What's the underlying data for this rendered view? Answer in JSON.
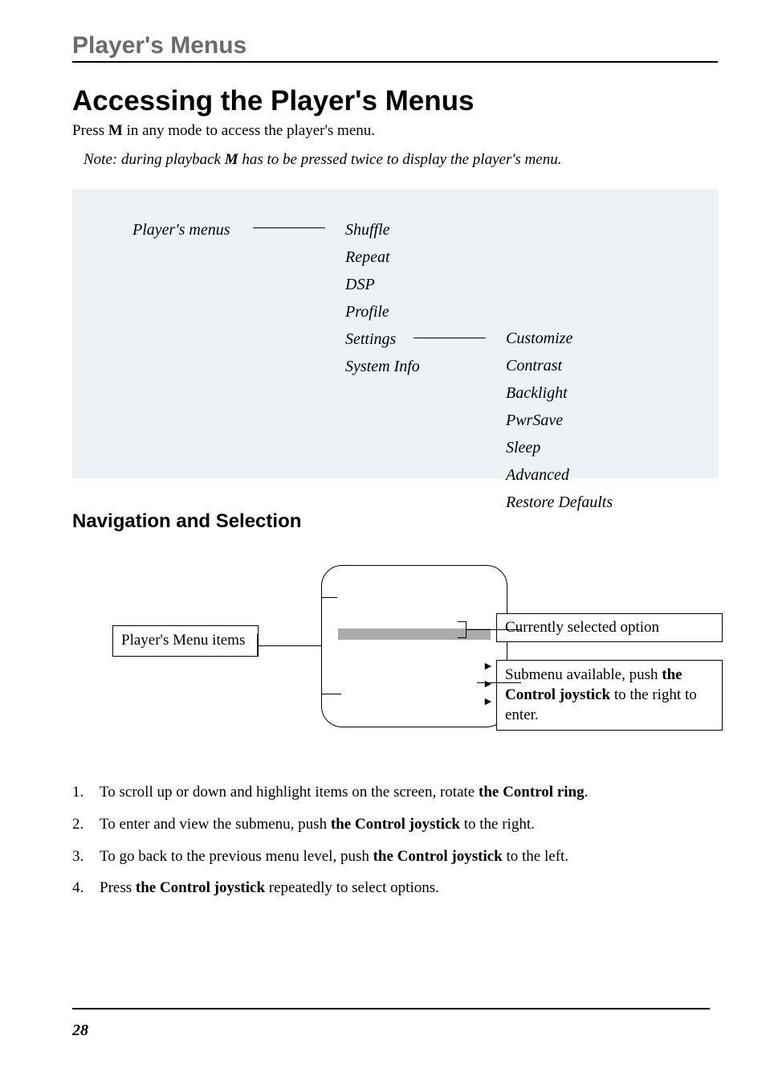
{
  "chapter": "Player's Menus",
  "h1": "Accessing the Player's Menus",
  "press1": "Press ",
  "press_key": "M",
  "press2": " in any mode to access the player's menu.",
  "note_pre": "Note: during playback ",
  "note_key": "M",
  "note_post": " has to be pressed twice to display the player's menu.",
  "menu_col1": "Player's menus",
  "menu_col2": [
    "Shuffle",
    "Repeat",
    "DSP",
    "Profile",
    "Settings",
    "System Info"
  ],
  "menu_col3": [
    "Customize",
    "Contrast",
    "Backlight",
    "PwrSave",
    "Sleep",
    "Advanced",
    "Restore Defaults"
  ],
  "h2": "Navigation and Selection",
  "diagram": {
    "left_label": "Player's Menu items",
    "top_right": "Currently selected option",
    "bottom_right_pre": "Submenu available, push ",
    "bottom_right_bold": "the Control joystick",
    "bottom_right_post": " to the right to enter."
  },
  "steps": [
    {
      "n": "1.",
      "pre": "To scroll up or down and highlight items on the screen, rotate ",
      "b": "the Control ring",
      "post": "."
    },
    {
      "n": "2.",
      "pre": "To enter and view the submenu, push ",
      "b": "the Control joystick",
      "post": " to the right."
    },
    {
      "n": "3.",
      "pre": "To go back to the previous menu level, push ",
      "b": "the Control joystick",
      "post": " to the left."
    },
    {
      "n": "4.",
      "pre": "Press ",
      "b": "the Control joystick",
      "post": " repeatedly to select options."
    }
  ],
  "page_number": "28"
}
